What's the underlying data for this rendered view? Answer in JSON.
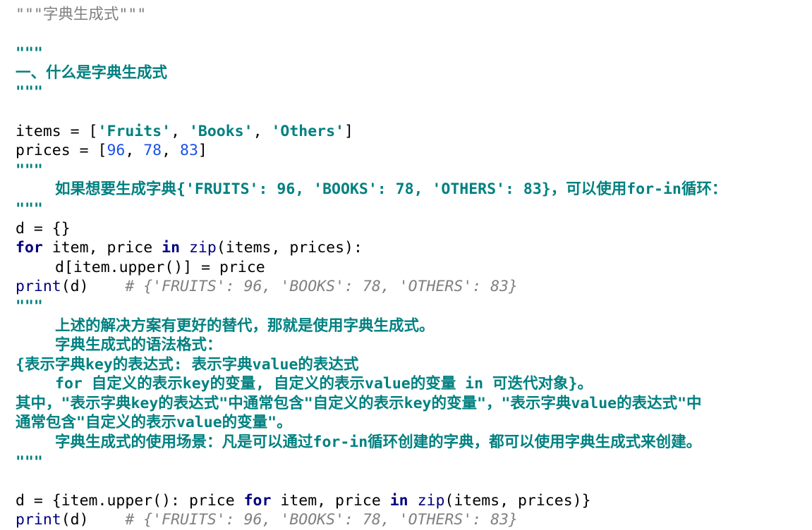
{
  "editor": {
    "module_docstring": "\"\"\"字典生成式\"\"\"",
    "ds_quote": "\"\"\"",
    "heading": "一、什么是字典生成式",
    "items_var": "items = [",
    "items_0": "'Fruits'",
    "comma_sep": ", ",
    "items_1": "'Books'",
    "items_2": "'Others'",
    "close_bracket": "]",
    "prices_var": "prices = [",
    "prices_0": "96",
    "prices_1": "78",
    "prices_2": "83",
    "for_in_intro": "如果想要生成字典{'FRUITS': 96, 'BOOKS': 78, 'OTHERS': 83}，可以使用for-in循环：",
    "d_init": "d = {}",
    "kw_for": "for",
    "loop_mid": " item, price ",
    "kw_in": "in",
    "space": " ",
    "bi_zip": "zip",
    "loop_args": "(items, prices):",
    "loop_body": "d[item.upper()] = price",
    "bi_print": "print",
    "print_args": "(d)    ",
    "result_comment": "# {'FRUITS': 96, 'BOOKS': 78, 'OTHERS': 83}",
    "doc_alt": "上述的解决方案有更好的替代，那就是使用字典生成式。",
    "doc_syntax_title": "字典生成式的语法格式：",
    "doc_syntax_1": "{表示字典key的表达式: 表示字典value的表达式",
    "doc_syntax_2": "for 自定义的表示key的变量, 自定义的表示value的变量 in 可迭代对象}。",
    "doc_note_1": "其中，\"表示字典key的表达式\"中通常包含\"自定义的表示key的变量\"，\"表示字典value的表达式\"中",
    "doc_note_2": "通常包含\"自定义的表示value的变量\"。",
    "doc_scene": "字典生成式的使用场景：凡是可以通过for-in循环创建的字典，都可以使用字典生成式来创建。",
    "comp_start": "d = {item.upper(): price ",
    "comp_mid": " item, price ",
    "comp_end": "(items, prices)}"
  },
  "colors": {
    "keyword": "#000080",
    "docstring": "#008080",
    "number": "#1750eb",
    "comment": "#808080"
  }
}
